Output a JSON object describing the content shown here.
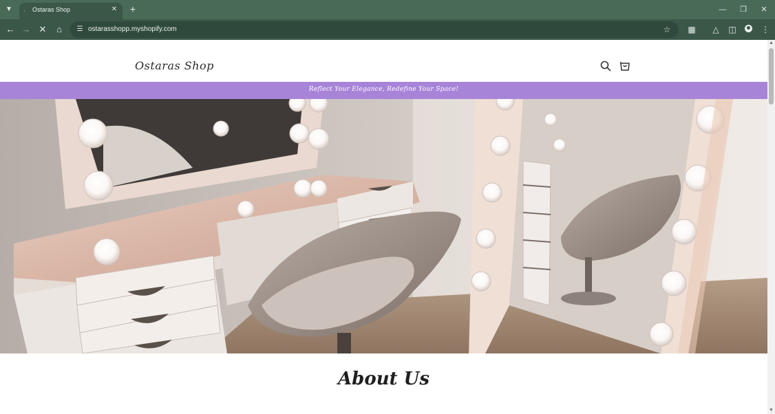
{
  "browser": {
    "tab": {
      "title": "Ostaras Shop",
      "favicon": "loading-dot-icon"
    },
    "url": "ostarasshopp.myshopify.com",
    "icons": {
      "tab_list": "chevron-down-icon",
      "new_tab": "plus-icon",
      "back": "back-arrow-icon",
      "forward": "forward-arrow-icon",
      "stop": "close-icon",
      "home": "home-icon",
      "site_info": "tune-icon",
      "bookmark": "star-icon",
      "extensions": "puzzle-icon",
      "labs": "flask-icon",
      "side_panel": "side-panel-icon",
      "profile": "avatar-icon",
      "menu": "kebab-menu-icon"
    },
    "colors": {
      "frame": "#4a6a58",
      "toolbar": "#3b5748",
      "omnibox": "#2f4a3c"
    }
  },
  "page": {
    "logo": "Ostaras Shop",
    "header_icons": [
      "search-icon",
      "cart-icon"
    ],
    "announcement": "Reflect Your Elegance, Redefine Your Space!",
    "hero_image": "vanity-room-photo",
    "section_title": "About Us",
    "colors": {
      "announcement_bar": "#a884d8",
      "background": "#ffffff"
    }
  }
}
